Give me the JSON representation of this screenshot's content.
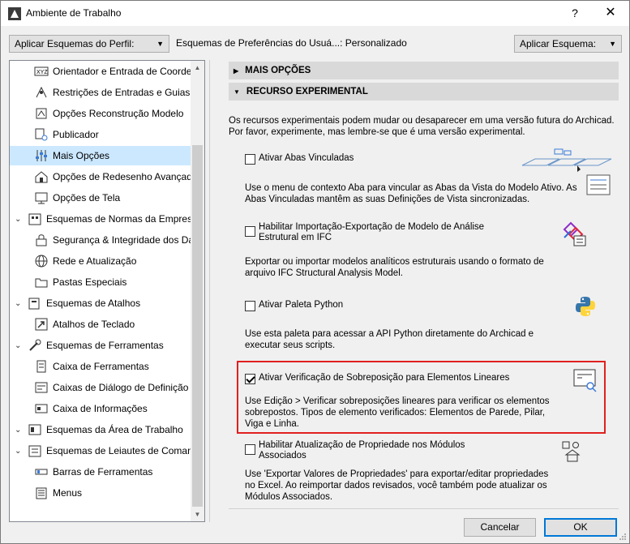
{
  "window": {
    "title": "Ambiente de Trabalho",
    "help_glyph": "?",
    "close_glyph": "✕"
  },
  "scheme_bar": {
    "apply_profile_label": "Aplicar Esquemas do Perfil:",
    "preference_label": "Esquemas de Preferências do Usuá...: Personalizado",
    "apply_scheme_label": "Aplicar Esquema:",
    "separator": ":"
  },
  "sidebar": {
    "items": [
      {
        "label": "Orientador e Entrada de Coorden",
        "icon": "xyz-icon",
        "level": 2
      },
      {
        "label": "Restrições de Entradas e Guias",
        "icon": "guides-icon",
        "level": 2
      },
      {
        "label": "Opções Reconstrução Modelo",
        "icon": "rebuild-icon",
        "level": 2
      },
      {
        "label": "Publicador",
        "icon": "publisher-icon",
        "level": 2
      },
      {
        "label": "Mais Opções",
        "icon": "sliders-icon",
        "level": 2,
        "selected": true
      },
      {
        "label": "Opções de Redesenho Avançada",
        "icon": "redraw-icon",
        "level": 2
      },
      {
        "label": "Opções de Tela",
        "icon": "screen-icon",
        "level": 2
      },
      {
        "label": "Esquemas de Normas da Empresa",
        "icon": "company-icon",
        "level": 1
      },
      {
        "label": "Segurança & Integridade dos Da",
        "icon": "security-icon",
        "level": 2
      },
      {
        "label": "Rede e Atualização",
        "icon": "globe-icon",
        "level": 2
      },
      {
        "label": "Pastas Especiais",
        "icon": "folder-icon",
        "level": 2
      },
      {
        "label": "Esquemas de Atalhos",
        "icon": "shortcuts-icon",
        "level": 1
      },
      {
        "label": "Atalhos de Teclado",
        "icon": "keyboard-shortcut-icon",
        "level": 2
      },
      {
        "label": "Esquemas de Ferramentas",
        "icon": "tools-icon",
        "level": 1
      },
      {
        "label": "Caixa de Ferramentas",
        "icon": "toolbox-icon",
        "level": 2
      },
      {
        "label": "Caixas de Diálogo de Definição d",
        "icon": "dialog-icon",
        "level": 2
      },
      {
        "label": "Caixa de Informações",
        "icon": "info-box-icon",
        "level": 2
      },
      {
        "label": "Esquemas da Área de Trabalho",
        "icon": "workspace-icon",
        "level": 1
      },
      {
        "label": "Esquemas de Leiautes de Comando",
        "icon": "command-layout-icon",
        "level": 1
      },
      {
        "label": "Barras de Ferramentas",
        "icon": "toolbar-icon",
        "level": 2
      },
      {
        "label": "Menus",
        "icon": "menus-icon",
        "level": 2
      }
    ]
  },
  "panel": {
    "more_options_header": "MAIS OPÇÕES",
    "experimental_header": "RECURSO EXPERIMENTAL",
    "intro_line1": "Os recursos experimentais podem mudar ou desaparecer em uma versão futura do Archicad.",
    "intro_line2": "Por favor, experimente, mas lembre-se que é uma versão experimental.",
    "options": [
      {
        "label": "Ativar Abas Vinculadas",
        "checked": false,
        "desc1": "Use o menu de contexto Aba para vincular as Abas da Vista do Modelo Ativo. As",
        "desc2": "Abas Vinculadas mantêm as suas Definições de Vista sincronizadas.",
        "icon": "linked-tabs-icon"
      },
      {
        "label1": "Habilitar Importação-Exportação de Modelo de Análise",
        "label2": "Estrutural em IFC",
        "checked": false,
        "desc1": "Exportar ou importar modelos analíticos estruturais usando o formato de",
        "desc2": "arquivo IFC Structural Analysis Model.",
        "icon": "ifc-icon"
      },
      {
        "label": "Ativar Paleta Python",
        "checked": false,
        "desc1": "Use esta paleta para acessar a API Python diretamente do Archicad e",
        "desc2": "executar seus scripts.",
        "icon": "python-icon"
      },
      {
        "label": "Ativar Verificação de Sobreposição para Elementos Lineares",
        "checked": true,
        "desc1": "Use Edição > Verificar sobreposições lineares para verificar os elementos",
        "desc2": "sobrepostos. Tipos de elemento verificados: Elementos de Parede, Pilar,",
        "desc3": "Viga e Linha.",
        "icon": "overlap-check-icon"
      },
      {
        "label1": "Habilitar Atualização de Propriedade nos Módulos",
        "label2": "Associados",
        "checked": false,
        "desc1": "Use 'Exportar Valores de Propriedades' para exportar/editar propriedades",
        "desc2": "no Excel. Ao reimportar dados revisados, você também pode atualizar os",
        "desc3": "Módulos Associados.",
        "icon": "module-update-icon"
      }
    ]
  },
  "footer": {
    "cancel_label": "Cancelar",
    "ok_label": "OK"
  },
  "colors": {
    "selection": "#cce8ff",
    "highlight_border": "#e02020",
    "primary_border": "#0078d7"
  }
}
